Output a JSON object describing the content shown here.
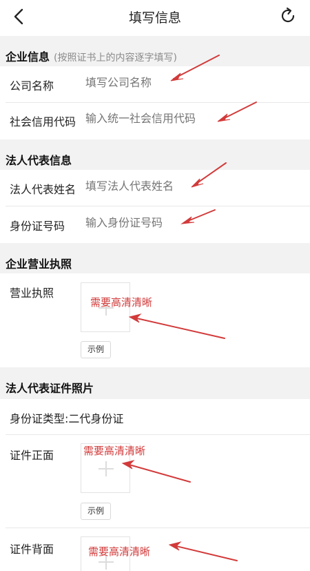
{
  "header": {
    "title": "填写信息"
  },
  "sections": {
    "company": {
      "title": "企业信息",
      "hint": "(按照证书上的内容逐字填写)",
      "fields": [
        {
          "label": "公司名称",
          "placeholder": "填写公司名称"
        },
        {
          "label": "社会信用代码",
          "placeholder": "输入统一社会信用代码"
        }
      ]
    },
    "legal_rep": {
      "title": "法人代表信息",
      "fields": [
        {
          "label": "法人代表姓名",
          "placeholder": "填写法人代表姓名"
        },
        {
          "label": "身份证号码",
          "placeholder": "输入身份证号码"
        }
      ]
    },
    "license": {
      "title": "企业营业执照",
      "label": "营业执照",
      "sample": "示例"
    },
    "id_photos": {
      "title": "法人代表证件照片",
      "id_type_label": "身份证类型:",
      "id_type_value": "二代身份证",
      "front_label": "证件正面",
      "back_label": "证件背面",
      "sample": "示例"
    }
  },
  "annotations": {
    "hd_note": "需要高清清晰",
    "color": "#d23a3a"
  }
}
